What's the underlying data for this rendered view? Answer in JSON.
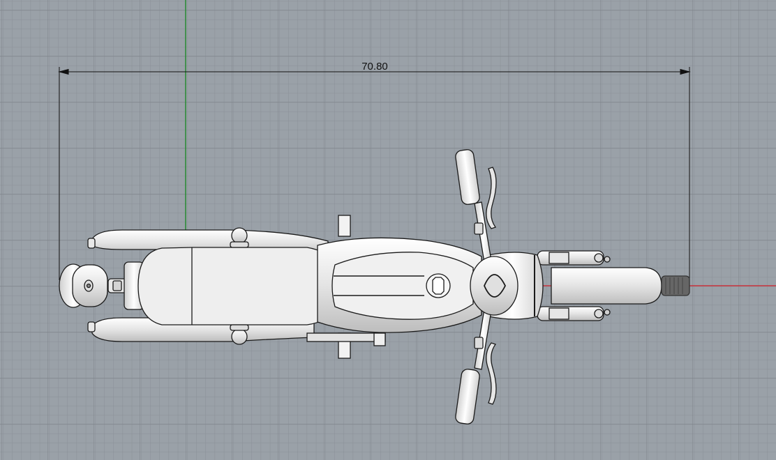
{
  "viewport": {
    "view": "Top",
    "dimension_label": "70.80",
    "colors": {
      "background": "#9aa1a8",
      "grid_minor": "#8a9097",
      "grid_major": "#7d838a",
      "x_axis": "#c8323c",
      "y_axis": "#2e8b3a",
      "model_fill": "#ececec",
      "model_stroke": "#1a1a1a",
      "dimension": "#111111"
    }
  },
  "model": {
    "name": "motorcycle",
    "icon": "motorcycle-top-view"
  }
}
